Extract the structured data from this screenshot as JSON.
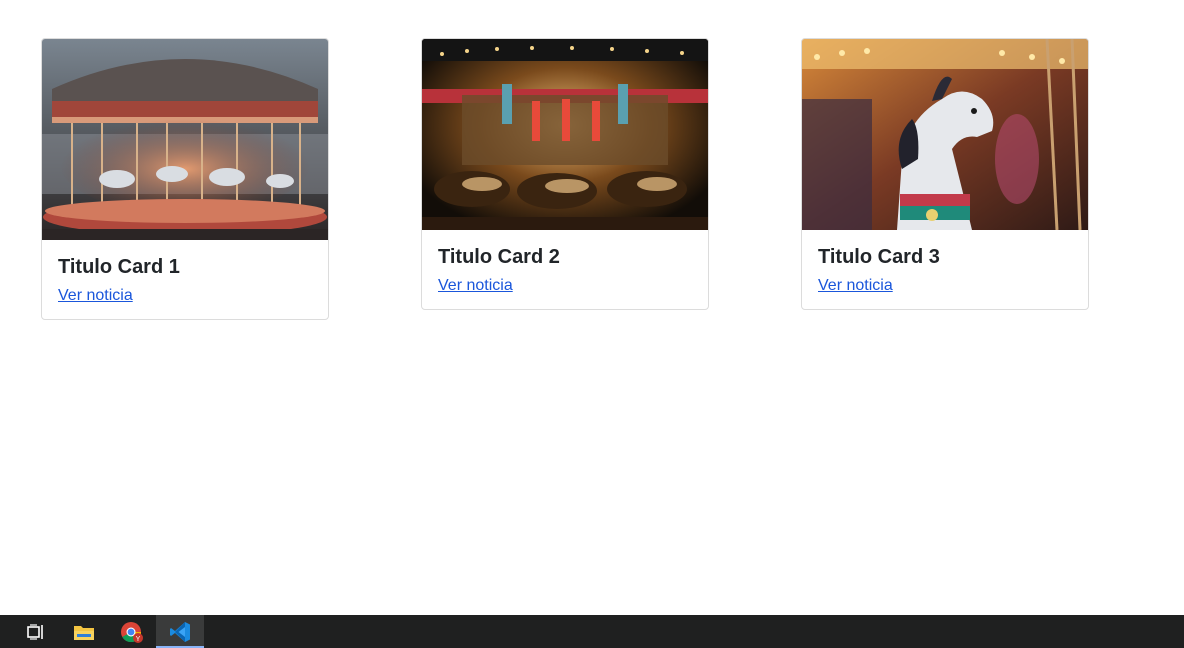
{
  "cards": [
    {
      "title": "Titulo Card 1",
      "link": "Ver noticia"
    },
    {
      "title": "Titulo Card 2",
      "link": "Ver noticia"
    },
    {
      "title": "Titulo Card 3",
      "link": "Ver noticia"
    }
  ],
  "taskbar": {
    "icons": [
      "task-view-icon",
      "file-explorer-icon",
      "chrome-icon",
      "vscode-icon"
    ],
    "active": "vscode-icon"
  },
  "colors": {
    "link": "#1a56db",
    "title": "#212529",
    "taskbar": "#1f2020"
  }
}
